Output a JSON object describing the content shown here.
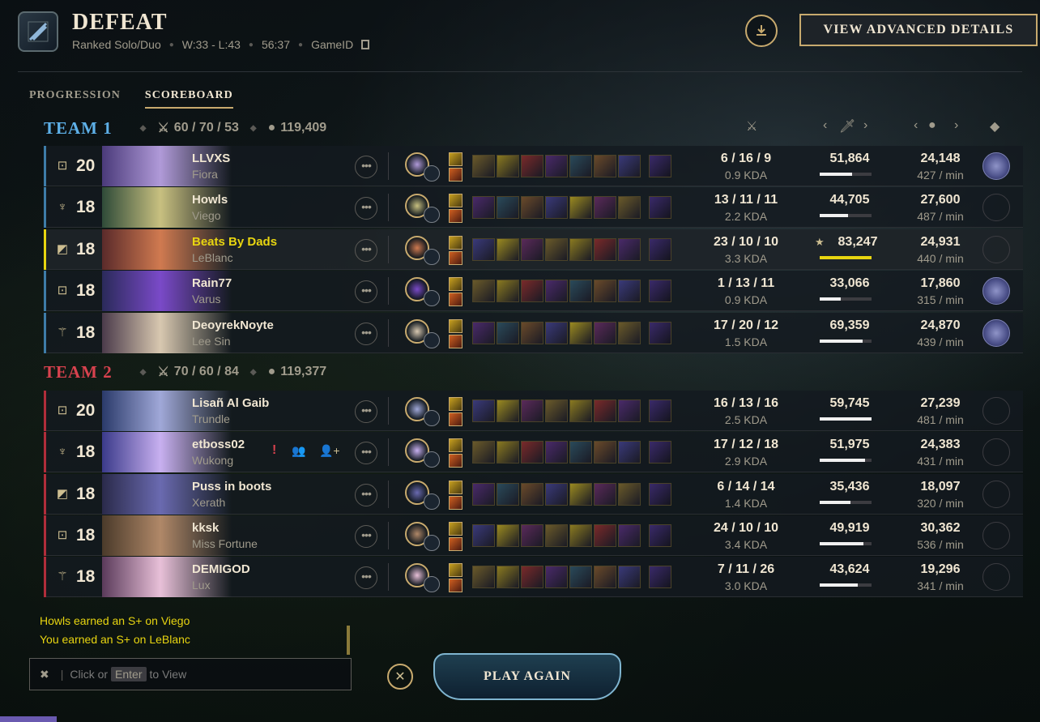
{
  "header": {
    "result": "DEFEAT",
    "queue": "Ranked Solo/Duo",
    "record": "W:33 - L:43",
    "duration": "56:37",
    "game_id_label": "GameID",
    "advanced_label": "VIEW ADVANCED DETAILS"
  },
  "tabs": [
    "PROGRESSION",
    "SCOREBOARD"
  ],
  "active_tab": "SCOREBOARD",
  "teams": [
    {
      "name": "TEAM 1",
      "kda": "60 / 70 / 53",
      "gold": "119,409",
      "players": [
        {
          "role": "top",
          "level": "20",
          "name": "LLVXS",
          "champion": "Fiora",
          "kda": "6 / 16 / 9",
          "kda_ratio": "0.9 KDA",
          "damage": "51,864",
          "damage_fraction": 0.62,
          "gold": "24,148",
          "gpm": "427 / min",
          "honor": true,
          "star": false,
          "me": false
        },
        {
          "role": "jungle",
          "level": "18",
          "name": "Howls",
          "champion": "Viego",
          "kda": "13 / 11 / 11",
          "kda_ratio": "2.2 KDA",
          "damage": "44,705",
          "damage_fraction": 0.54,
          "gold": "27,600",
          "gpm": "487 / min",
          "honor": false,
          "star": false,
          "me": false
        },
        {
          "role": "mid",
          "level": "18",
          "name": "Beats By Dads",
          "champion": "LeBlanc",
          "kda": "23 / 10 / 10",
          "kda_ratio": "3.3 KDA",
          "damage": "83,247",
          "damage_fraction": 1.0,
          "gold": "24,931",
          "gpm": "440 / min",
          "honor": false,
          "star": true,
          "me": true
        },
        {
          "role": "bot",
          "level": "18",
          "name": "Rain77",
          "champion": "Varus",
          "kda": "1 / 13 / 11",
          "kda_ratio": "0.9 KDA",
          "damage": "33,066",
          "damage_fraction": 0.4,
          "gold": "17,860",
          "gpm": "315 / min",
          "honor": true,
          "star": false,
          "me": false
        },
        {
          "role": "support",
          "level": "18",
          "name": "DeoyrekNoyte",
          "champion": "Lee Sin",
          "kda": "17 / 20 / 12",
          "kda_ratio": "1.5 KDA",
          "damage": "69,359",
          "damage_fraction": 0.83,
          "gold": "24,870",
          "gpm": "439 / min",
          "honor": true,
          "star": false,
          "me": false
        }
      ]
    },
    {
      "name": "TEAM 2",
      "kda": "70 / 60 / 84",
      "gold": "119,377",
      "players": [
        {
          "role": "top",
          "level": "20",
          "name": "Lisañ Al Gaib",
          "champion": "Trundle",
          "kda": "16 / 13 / 16",
          "kda_ratio": "2.5 KDA",
          "damage": "59,745",
          "damage_fraction": 1.0,
          "gold": "27,239",
          "gpm": "481 / min",
          "honor": false,
          "star": false,
          "me": false
        },
        {
          "role": "jungle",
          "level": "18",
          "name": "etboss02",
          "champion": "Wukong",
          "kda": "17 / 12 / 18",
          "kda_ratio": "2.9 KDA",
          "damage": "51,975",
          "damage_fraction": 0.87,
          "gold": "24,383",
          "gpm": "431 / min",
          "honor": false,
          "star": false,
          "me": false,
          "actions": true
        },
        {
          "role": "mid",
          "level": "18",
          "name": "Puss in boots",
          "champion": "Xerath",
          "kda": "6 / 14 / 14",
          "kda_ratio": "1.4 KDA",
          "damage": "35,436",
          "damage_fraction": 0.59,
          "gold": "18,097",
          "gpm": "320 / min",
          "honor": false,
          "star": false,
          "me": false
        },
        {
          "role": "bot",
          "level": "18",
          "name": "kksk",
          "champion": "Miss Fortune",
          "kda": "24 / 10 / 10",
          "kda_ratio": "3.4 KDA",
          "damage": "49,919",
          "damage_fraction": 0.84,
          "gold": "30,362",
          "gpm": "536 / min",
          "honor": false,
          "star": false,
          "me": false
        },
        {
          "role": "support",
          "level": "18",
          "name": "DEMIGOD",
          "champion": "Lux",
          "kda": "7 / 11 / 26",
          "kda_ratio": "3.0 KDA",
          "damage": "43,624",
          "damage_fraction": 0.73,
          "gold": "19,296",
          "gpm": "341 / min",
          "honor": false,
          "star": false,
          "me": false
        }
      ]
    }
  ],
  "chat": {
    "messages": [
      "Howls earned an S+ on Viego",
      "You earned an S+ on LeBlanc"
    ],
    "input_prefix": "Click or",
    "input_key": "Enter",
    "input_suffix": "to View"
  },
  "play_again_label": "PLAY AGAIN",
  "colors": {
    "gold": "#c8aa6e",
    "team1": "#5eb0e8",
    "team2": "#d8424e",
    "me": "#e8d510"
  }
}
